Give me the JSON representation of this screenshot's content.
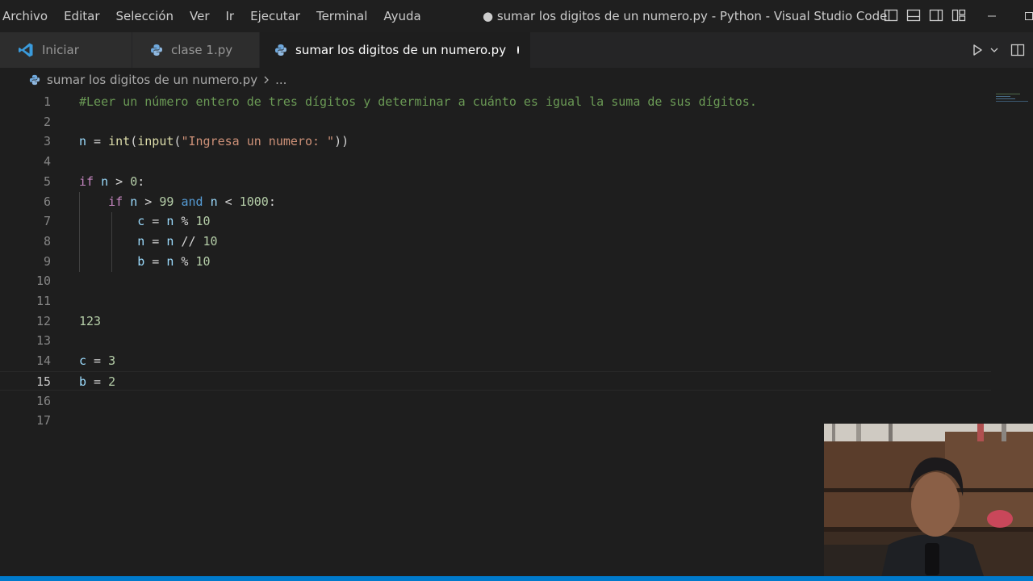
{
  "menu": [
    "Archivo",
    "Editar",
    "Selección",
    "Ver",
    "Ir",
    "Ejecutar",
    "Terminal",
    "Ayuda"
  ],
  "window_title": "● sumar los digitos de un numero.py - Python - Visual Studio Code",
  "tabs": [
    {
      "label": "Iniciar",
      "icon": "vscode-logo-icon"
    },
    {
      "label": "clase 1.py",
      "icon": "python-file-icon"
    },
    {
      "label": "sumar los digitos de un numero.py",
      "icon": "python-file-icon",
      "active": true,
      "dirty": true
    }
  ],
  "breadcrumb": {
    "file": "sumar los digitos de un numero.py",
    "more": "..."
  },
  "editor": {
    "current_line": 15,
    "lines": [
      {
        "n": "1",
        "tokens": [
          [
            "cmt",
            "#Leer un número entero de tres dígitos y determinar a cuánto es igual la suma de sus dígitos."
          ]
        ]
      },
      {
        "n": "2",
        "tokens": []
      },
      {
        "n": "3",
        "tokens": [
          [
            "var",
            "n"
          ],
          [
            "op",
            " = "
          ],
          [
            "fn",
            "int"
          ],
          [
            "op",
            "("
          ],
          [
            "fn",
            "input"
          ],
          [
            "op",
            "("
          ],
          [
            "str",
            "\"Ingresa un numero: \""
          ],
          [
            "op",
            "))"
          ]
        ]
      },
      {
        "n": "4",
        "tokens": []
      },
      {
        "n": "5",
        "tokens": [
          [
            "kw",
            "if"
          ],
          [
            "op",
            " "
          ],
          [
            "var",
            "n"
          ],
          [
            "op",
            " > "
          ],
          [
            "num",
            "0"
          ],
          [
            "op",
            ":"
          ]
        ]
      },
      {
        "n": "6",
        "tokens": [
          [
            "op",
            "    "
          ],
          [
            "kw",
            "if"
          ],
          [
            "op",
            " "
          ],
          [
            "var",
            "n"
          ],
          [
            "op",
            " > "
          ],
          [
            "num",
            "99"
          ],
          [
            "op",
            " "
          ],
          [
            "kw2",
            "and"
          ],
          [
            "op",
            " "
          ],
          [
            "var",
            "n"
          ],
          [
            "op",
            " < "
          ],
          [
            "num",
            "1000"
          ],
          [
            "op",
            ":"
          ]
        ]
      },
      {
        "n": "7",
        "tokens": [
          [
            "op",
            "        "
          ],
          [
            "var",
            "c"
          ],
          [
            "op",
            " = "
          ],
          [
            "var",
            "n"
          ],
          [
            "op",
            " % "
          ],
          [
            "num",
            "10"
          ]
        ]
      },
      {
        "n": "8",
        "tokens": [
          [
            "op",
            "        "
          ],
          [
            "var",
            "n"
          ],
          [
            "op",
            " = "
          ],
          [
            "var",
            "n"
          ],
          [
            "op",
            " // "
          ],
          [
            "num",
            "10"
          ]
        ]
      },
      {
        "n": "9",
        "tokens": [
          [
            "op",
            "        "
          ],
          [
            "var",
            "b"
          ],
          [
            "op",
            " = "
          ],
          [
            "var",
            "n"
          ],
          [
            "op",
            " % "
          ],
          [
            "num",
            "10"
          ]
        ]
      },
      {
        "n": "10",
        "tokens": []
      },
      {
        "n": "11",
        "tokens": []
      },
      {
        "n": "12",
        "tokens": [
          [
            "num",
            "123"
          ]
        ]
      },
      {
        "n": "13",
        "tokens": []
      },
      {
        "n": "14",
        "tokens": [
          [
            "var",
            "c"
          ],
          [
            "op",
            " = "
          ],
          [
            "num",
            "3"
          ]
        ]
      },
      {
        "n": "15",
        "tokens": [
          [
            "var",
            "b"
          ],
          [
            "op",
            " = "
          ],
          [
            "num",
            "2"
          ]
        ]
      },
      {
        "n": "16",
        "tokens": []
      },
      {
        "n": "17",
        "tokens": []
      }
    ]
  },
  "colors": {
    "accent": "#007acc",
    "comment": "#6a9955",
    "keyword": "#c586c0",
    "variable": "#9cdcfe",
    "function": "#dcdcaa",
    "string": "#ce9178",
    "number": "#b5cea8"
  },
  "icons": [
    "toggle-primary-sidebar-icon",
    "toggle-panel-icon",
    "toggle-secondary-sidebar-icon",
    "customize-layout-icon",
    "minimize-icon",
    "maximize-icon",
    "run-icon",
    "chevron-down-icon",
    "split-editor-icon",
    "chevron-right-icon"
  ]
}
